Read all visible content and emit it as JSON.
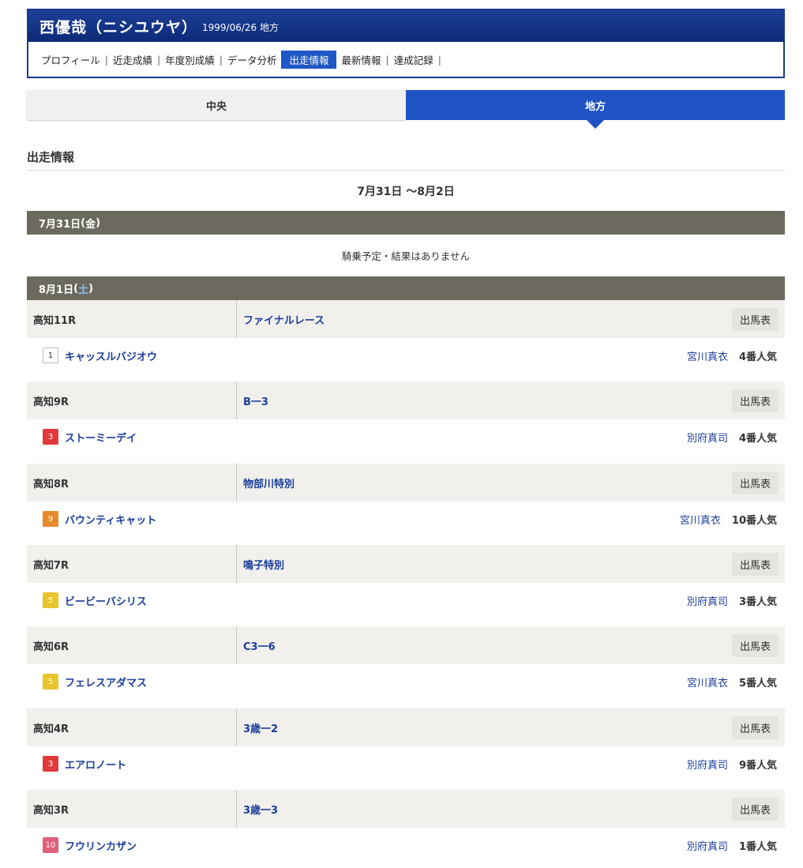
{
  "profile": {
    "name": "西優哉（ニシユウヤ）",
    "meta": "1999/06/26 地方",
    "nav": [
      {
        "label": "プロフィール",
        "active": false
      },
      {
        "label": "近走成績",
        "active": false
      },
      {
        "label": "年度別成績",
        "active": false
      },
      {
        "label": "データ分析",
        "active": false
      },
      {
        "label": "出走情報",
        "active": true
      },
      {
        "label": "最新情報",
        "active": false
      },
      {
        "label": "達成記録",
        "active": false
      }
    ],
    "separator": "|"
  },
  "tabs": [
    {
      "label": "中央",
      "active": false
    },
    {
      "label": "地方",
      "active": true
    }
  ],
  "section_title": "出走情報",
  "date_range": "7月31日 〜8月2日",
  "days": [
    {
      "date": "7月31日",
      "dow": "金",
      "no_ride": "騎乗予定・結果はありません"
    },
    {
      "date": "8月1日",
      "dow": "土"
    }
  ],
  "paren_open": "(",
  "paren_close": ")",
  "entry_label": "出馬表",
  "races": [
    {
      "race": "高知11R",
      "name": "ファイナルレース",
      "gate": "1",
      "gate_color": "#ffffff",
      "horse": "キャッスルバジオウ",
      "jockey": "宮川真衣",
      "popularity": "4番人気"
    },
    {
      "race": "高知9R",
      "name": "B一3",
      "gate": "3",
      "gate_color": "#e03a3a",
      "horse": "ストーミーデイ",
      "jockey": "別府真司",
      "popularity": "4番人気"
    },
    {
      "race": "高知8R",
      "name": "物部川特別",
      "gate": "9",
      "gate_color": "#e88a2b",
      "horse": "バウンティキャット",
      "jockey": "宮川真衣",
      "popularity": "10番人気"
    },
    {
      "race": "高知7R",
      "name": "鳴子特別",
      "gate": "5",
      "gate_color": "#e8c52c",
      "horse": "ビービーバシリス",
      "jockey": "別府真司",
      "popularity": "3番人気"
    },
    {
      "race": "高知6R",
      "name": "C3一6",
      "gate": "5",
      "gate_color": "#e8c52c",
      "horse": "フェレスアダマス",
      "jockey": "宮川真衣",
      "popularity": "5番人気"
    },
    {
      "race": "高知4R",
      "name": "3歳一2",
      "gate": "3",
      "gate_color": "#e03a3a",
      "horse": "エアロノート",
      "jockey": "別府真司",
      "popularity": "9番人気"
    },
    {
      "race": "高知3R",
      "name": "3歳一3",
      "gate": "10",
      "gate_color": "#e0607a",
      "horse": "フウリンカザン",
      "jockey": "別府真司",
      "popularity": "1番人気"
    }
  ]
}
